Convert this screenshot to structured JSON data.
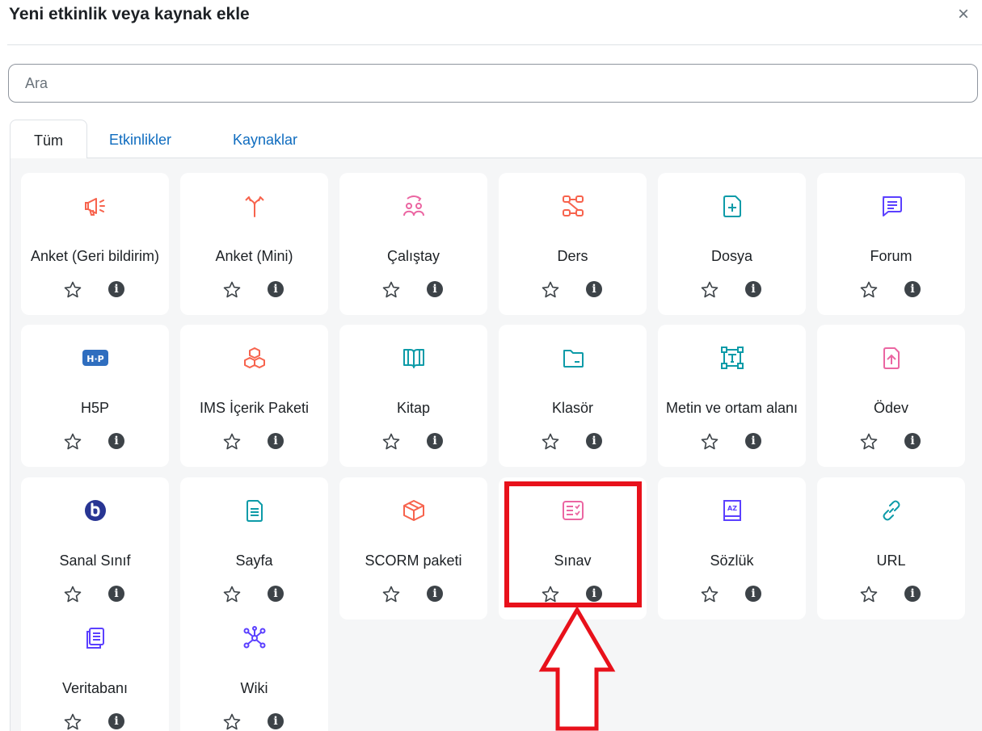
{
  "modal": {
    "title": "Yeni etkinlik veya kaynak ekle",
    "close": "×"
  },
  "search": {
    "placeholder": "Ara",
    "value": ""
  },
  "tabs": [
    {
      "label": "Tüm"
    },
    {
      "label": "Etkinlikler"
    },
    {
      "label": "Kaynaklar"
    }
  ],
  "cards": [
    {
      "label": "Anket (Geri bildirim)",
      "icon": "megaphone-icon",
      "color": "#f7634d"
    },
    {
      "label": "Anket (Mini)",
      "icon": "fork-icon",
      "color": "#f7634d"
    },
    {
      "label": "Çalıştay",
      "icon": "workshop-icon",
      "color": "#eb66a2"
    },
    {
      "label": "Ders",
      "icon": "lesson-icon",
      "color": "#f7634d"
    },
    {
      "label": "Dosya",
      "icon": "file-icon",
      "color": "#0d9ba8"
    },
    {
      "label": "Forum",
      "icon": "forum-icon",
      "color": "#5b40ff"
    },
    {
      "label": "H5P",
      "icon": "h5p-icon",
      "color": "#2f6ebf"
    },
    {
      "label": "IMS İçerik Paketi",
      "icon": "package-icon",
      "color": "#f7634d"
    },
    {
      "label": "Kitap",
      "icon": "book-icon",
      "color": "#0d9ba8"
    },
    {
      "label": "Klasör",
      "icon": "folder-icon",
      "color": "#0d9ba8"
    },
    {
      "label": "Metin ve ortam alanı",
      "icon": "text-area-icon",
      "color": "#0d9ba8"
    },
    {
      "label": "Ödev",
      "icon": "assignment-icon",
      "color": "#eb66a2"
    },
    {
      "label": "Sanal Sınıf",
      "icon": "bigbluebutton-icon",
      "color": "#283593"
    },
    {
      "label": "Sayfa",
      "icon": "page-icon",
      "color": "#0d9ba8"
    },
    {
      "label": "SCORM paketi",
      "icon": "scorm-icon",
      "color": "#f7634d"
    },
    {
      "label": "Sınav",
      "icon": "quiz-icon",
      "color": "#eb66a2"
    },
    {
      "label": "Sözlük",
      "icon": "glossary-icon",
      "color": "#5b40ff"
    },
    {
      "label": "URL",
      "icon": "link-icon",
      "color": "#0d9ba8"
    },
    {
      "label": "Veritabanı",
      "icon": "database-icon",
      "color": "#5b40ff"
    },
    {
      "label": "Wiki",
      "icon": "wiki-icon",
      "color": "#5b40ff"
    }
  ],
  "card_actions": {
    "star_icon": "star-outline-icon",
    "info_icon": "info-icon",
    "info_glyph": "i"
  },
  "annotation": {
    "highlight_color": "#e8111b",
    "highlighted_item": "Sınav"
  }
}
